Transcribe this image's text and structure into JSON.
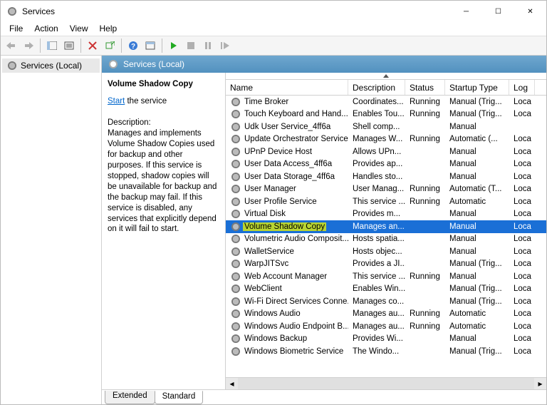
{
  "window": {
    "title": "Services"
  },
  "menu": [
    "File",
    "Action",
    "View",
    "Help"
  ],
  "tree_root": "Services (Local)",
  "subheader": "Services (Local)",
  "detail": {
    "title": "Volume Shadow Copy",
    "action_link": "Start",
    "action_rest": " the service",
    "desc_label": "Description:",
    "desc": "Manages and implements Volume Shadow Copies used for backup and other purposes. If this service is stopped, shadow copies will be unavailable for backup and the backup may fail. If this service is disabled, any services that explicitly depend on it will fail to start."
  },
  "columns": [
    "Name",
    "Description",
    "Status",
    "Startup Type",
    "Log"
  ],
  "rows": [
    {
      "name": "Time Broker",
      "desc": "Coordinates...",
      "status": "Running",
      "start": "Manual (Trig...",
      "log": "Loca"
    },
    {
      "name": "Touch Keyboard and Hand...",
      "desc": "Enables Tou...",
      "status": "Running",
      "start": "Manual (Trig...",
      "log": "Loca"
    },
    {
      "name": "Udk User Service_4ff6a",
      "desc": "Shell comp...",
      "status": "",
      "start": "Manual",
      "log": ""
    },
    {
      "name": "Update Orchestrator Service",
      "desc": "Manages W...",
      "status": "Running",
      "start": "Automatic (...",
      "log": "Loca"
    },
    {
      "name": "UPnP Device Host",
      "desc": "Allows UPn...",
      "status": "",
      "start": "Manual",
      "log": "Loca"
    },
    {
      "name": "User Data Access_4ff6a",
      "desc": "Provides ap...",
      "status": "",
      "start": "Manual",
      "log": "Loca"
    },
    {
      "name": "User Data Storage_4ff6a",
      "desc": "Handles sto...",
      "status": "",
      "start": "Manual",
      "log": "Loca"
    },
    {
      "name": "User Manager",
      "desc": "User Manag...",
      "status": "Running",
      "start": "Automatic (T...",
      "log": "Loca"
    },
    {
      "name": "User Profile Service",
      "desc": "This service ...",
      "status": "Running",
      "start": "Automatic",
      "log": "Loca"
    },
    {
      "name": "Virtual Disk",
      "desc": "Provides m...",
      "status": "",
      "start": "Manual",
      "log": "Loca"
    },
    {
      "name": "Volume Shadow Copy",
      "desc": "Manages an...",
      "status": "",
      "start": "Manual",
      "log": "Loca",
      "selected": true,
      "highlight": true
    },
    {
      "name": "Volumetric Audio Composit...",
      "desc": "Hosts spatia...",
      "status": "",
      "start": "Manual",
      "log": "Loca"
    },
    {
      "name": "WalletService",
      "desc": "Hosts objec...",
      "status": "",
      "start": "Manual",
      "log": "Loca"
    },
    {
      "name": "WarpJITSvc",
      "desc": "Provides a JI...",
      "status": "",
      "start": "Manual (Trig...",
      "log": "Loca"
    },
    {
      "name": "Web Account Manager",
      "desc": "This service ...",
      "status": "Running",
      "start": "Manual",
      "log": "Loca"
    },
    {
      "name": "WebClient",
      "desc": "Enables Win...",
      "status": "",
      "start": "Manual (Trig...",
      "log": "Loca"
    },
    {
      "name": "Wi-Fi Direct Services Conne...",
      "desc": "Manages co...",
      "status": "",
      "start": "Manual (Trig...",
      "log": "Loca"
    },
    {
      "name": "Windows Audio",
      "desc": "Manages au...",
      "status": "Running",
      "start": "Automatic",
      "log": "Loca"
    },
    {
      "name": "Windows Audio Endpoint B...",
      "desc": "Manages au...",
      "status": "Running",
      "start": "Automatic",
      "log": "Loca"
    },
    {
      "name": "Windows Backup",
      "desc": "Provides Wi...",
      "status": "",
      "start": "Manual",
      "log": "Loca"
    },
    {
      "name": "Windows Biometric Service",
      "desc": "The Windo...",
      "status": "",
      "start": "Manual (Trig...",
      "log": "Loca"
    }
  ],
  "tabs": [
    "Extended",
    "Standard"
  ],
  "active_tab": 1
}
